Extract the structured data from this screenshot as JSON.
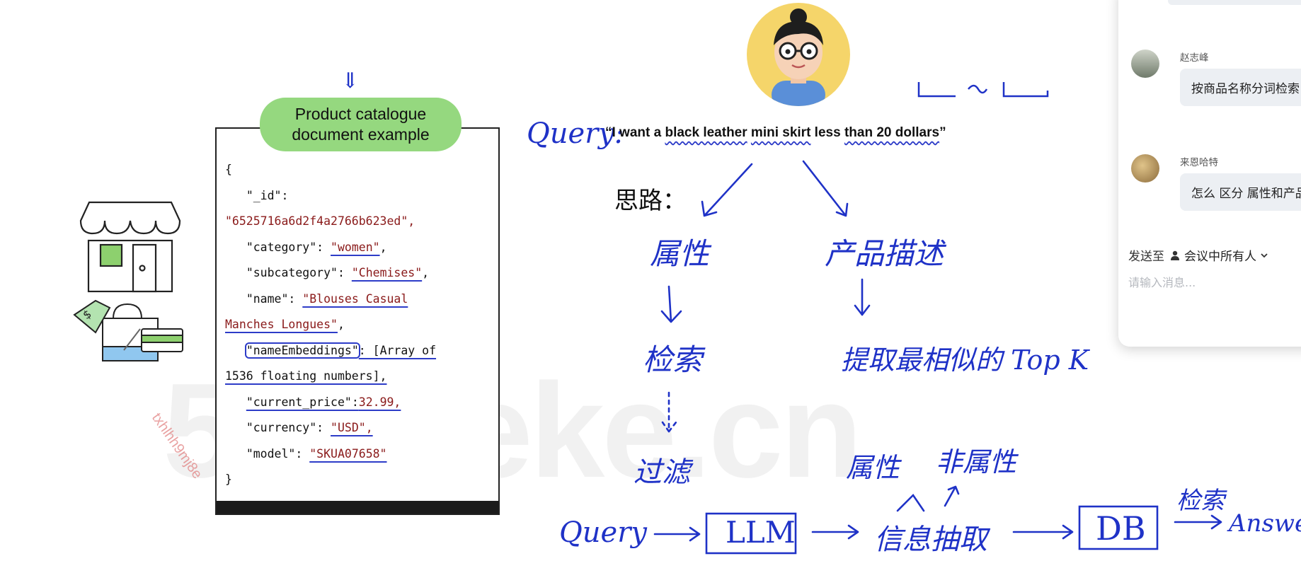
{
  "watermark": {
    "site": "58xueke.cn",
    "user_id": "txhlhh9mj8e"
  },
  "card": {
    "arrow": "⇓",
    "title_line1": "Product catalogue",
    "title_line2": "document example",
    "code": {
      "open": "{",
      "id_key": "\"_id\":",
      "id_val": "\"6525716a6d2f4a2766b623ed\",",
      "category_key": "\"category\": ",
      "category_val": "\"women\"",
      "subcategory_key": "\"subcategory\": ",
      "subcategory_val": "\"Chemises\"",
      "name_key": "\"name\": ",
      "name_val1": "\"Blouses Casual",
      "name_val2": "Manches Longues\"",
      "emb_key": "\"nameEmbeddings\"",
      "emb_val1": ": [Array of",
      "emb_val2": "1536 floating numbers],",
      "price_key": "\"current_price\":",
      "price_val": "32.99,",
      "currency_key": "\"currency\": ",
      "currency_val": "\"USD\",",
      "model_key": "\"model\": ",
      "model_val": "\"SKUA07658\"",
      "close": "}"
    }
  },
  "query": {
    "label": "Query:",
    "quote_open": "“I want a ",
    "w1": "black leather",
    "w2": " ",
    "w3": "mini skirt",
    "w4": " less ",
    "w5": "than 20 dollars",
    "quote_close": "”"
  },
  "diagram": {
    "silu": "思路：",
    "attr": "属性",
    "desc": "产品描述",
    "search": "检索",
    "extract_topk": "提取最相似的 Top K",
    "filter": "过滤",
    "query_label": "Query",
    "llm": "LLM",
    "info_extract": "信息抽取",
    "attr2": "属性",
    "non_attr": "非属性",
    "db": "DB",
    "retrieve": "检索",
    "answer": "Answer"
  },
  "chat": {
    "messages": [
      {
        "name": "赵志峰",
        "text": "按商品名称分词检索"
      },
      {
        "name": "来恩哈特",
        "text": "怎么 区分 属性和产品"
      }
    ],
    "send_to_label": "发送至",
    "send_to_target": "会议中所有人",
    "input_placeholder": "请输入消息..."
  },
  "colors": {
    "ink": "#1f32c7",
    "title_pill": "#95d87f",
    "string_red": "#8a1a1a"
  }
}
